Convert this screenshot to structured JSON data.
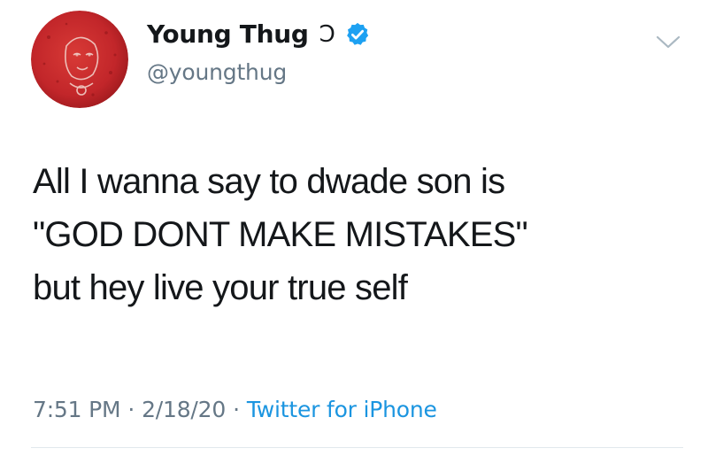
{
  "author": {
    "display_name": "Young Thug",
    "name_symbol": "Ɔ",
    "handle": "@youngthug",
    "verified": true,
    "avatar_icon": "avatar-red-illustration"
  },
  "tweet": {
    "lines": [
      "All I wanna say to dwade son is",
      "\"GOD DONT MAKE MISTAKES\"",
      "but hey live your true self"
    ]
  },
  "meta": {
    "time": "7:51 PM",
    "separator": "·",
    "date": "2/18/20",
    "source": "Twitter for iPhone"
  },
  "colors": {
    "text": "#14171a",
    "secondary": "#657786",
    "link": "#1b95e0",
    "verified": "#1da1f2",
    "avatar_red": "#c8282a"
  },
  "icons": {
    "verified": "verified-badge-icon",
    "menu": "chevron-down-icon"
  }
}
